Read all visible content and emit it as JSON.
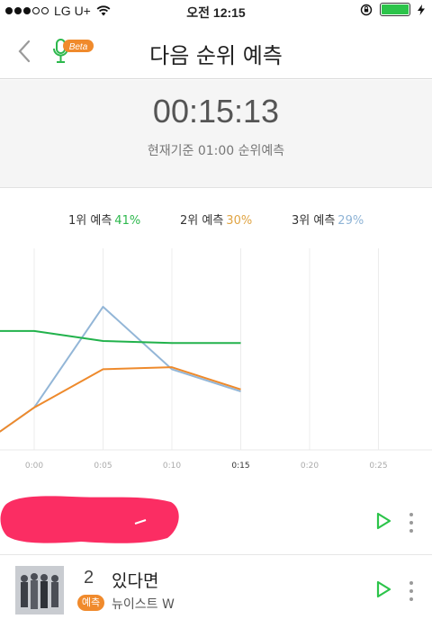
{
  "status_bar": {
    "carrier": "LG U+",
    "time": "오전 12:15",
    "signal_filled": 3,
    "signal_total": 5,
    "battery_level": 1.0
  },
  "header": {
    "title": "다음 순위 예측",
    "beta_label": "Beta",
    "back_icon": "chevron-left-icon"
  },
  "timer": {
    "countdown": "00:15:13",
    "subtitle": "현재기준 01:00 순위예측"
  },
  "legend": [
    {
      "label": "1위 예측",
      "pct": "41%",
      "color": "#2db84d"
    },
    {
      "label": "2위 예측",
      "pct": "30%",
      "color": "#e0a443"
    },
    {
      "label": "3위 예측",
      "pct": "29%",
      "color": "#8fb4d6"
    }
  ],
  "chart_data": {
    "type": "line",
    "x": [
      "0:00",
      "0:05",
      "0:10",
      "0:15",
      "0:20",
      "0:25"
    ],
    "x_current": "0:15",
    "ylim": [
      0,
      100
    ],
    "series": [
      {
        "color": "#22b24c",
        "points": [
          [
            -2.5,
            59
          ],
          [
            0,
            59
          ],
          [
            5,
            54
          ],
          [
            10,
            53
          ],
          [
            15,
            53
          ]
        ]
      },
      {
        "color": "#ee8a2c",
        "points": [
          [
            -2.5,
            9
          ],
          [
            0,
            21
          ],
          [
            5,
            40
          ],
          [
            10,
            41
          ],
          [
            15,
            30
          ]
        ]
      },
      {
        "color": "#93b6d7",
        "points": [
          [
            -2.5,
            9
          ],
          [
            0,
            21
          ],
          [
            5,
            71
          ],
          [
            10,
            40
          ],
          [
            15,
            29
          ]
        ]
      }
    ]
  },
  "songs": [
    {
      "rank": "",
      "title": "",
      "artist": "",
      "badge": "",
      "redacted": true
    },
    {
      "rank": "2",
      "title": "있다면",
      "artist": "뉴이스트 W",
      "badge": "예측"
    }
  ],
  "icons": {
    "play": "play-icon",
    "more": "more-vertical-icon"
  }
}
